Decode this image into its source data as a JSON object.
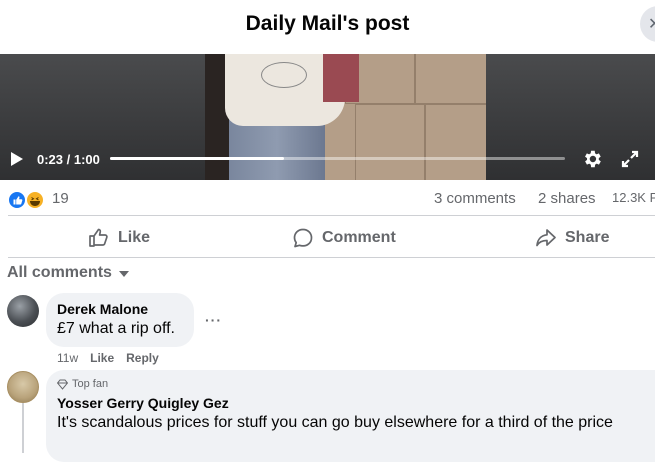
{
  "header": {
    "title": "Daily Mail's post",
    "close_icon": "close-icon"
  },
  "video": {
    "time": "0:23 / 1:00",
    "progress": 0.383,
    "play_icon": "play-icon",
    "settings_icon": "gear-icon",
    "fullscreen_icon": "fullscreen-icon"
  },
  "stats": {
    "reaction_icons": [
      "like-icon",
      "haha-icon"
    ],
    "reaction_count": "19",
    "comments": "3 comments",
    "shares": "2 shares",
    "views": "12.3K P"
  },
  "actions": {
    "like": "Like",
    "comment": "Comment",
    "share": "Share"
  },
  "comments_filter": {
    "label": "All comments"
  },
  "comments": [
    {
      "author": "Derek Malone",
      "text": "£7 what a rip off.",
      "time": "11w",
      "like": "Like",
      "reply": "Reply"
    },
    {
      "badge": "Top fan",
      "author": "Yosser Gerry Quigley Gez",
      "text": "It's scandalous prices for stuff you can go buy elsewhere for a third of the price"
    }
  ],
  "colors": {
    "text_primary": "#050505",
    "text_secondary": "#65676b",
    "bubble": "#f0f2f5",
    "like_blue": "#1877f2",
    "haha_yellow": "#f7b125"
  }
}
